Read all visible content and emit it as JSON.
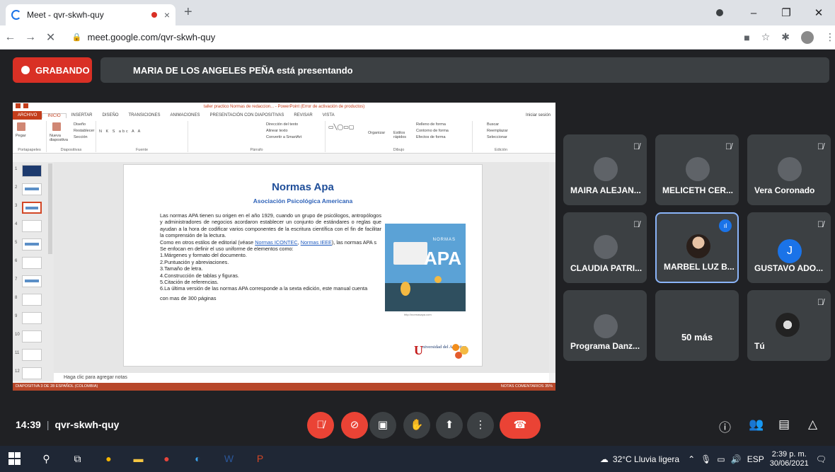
{
  "browser": {
    "tab_title": "Meet - qvr-skwh-quy",
    "url": "meet.google.com/qvr-skwh-quy",
    "new_tab": "+",
    "tab_close": "×"
  },
  "meet": {
    "recording_label": "GRABANDO",
    "presenting_label": "MARIA DE LOS ANGELES PEÑA está presentando",
    "time": "14:39",
    "meeting_code": "qvr-skwh-quy",
    "more_participants": "50 más"
  },
  "participants": [
    {
      "name": "MAIRA ALEJAN..."
    },
    {
      "name": "MELICETH CER..."
    },
    {
      "name": "Vera Coronado"
    },
    {
      "name": "CLAUDIA PATRI..."
    },
    {
      "name": "MARBEL LUZ B..."
    },
    {
      "name": "GUSTAVO ADO...",
      "initial": "J"
    },
    {
      "name": "Programa Danz..."
    },
    {
      "name": "Tú"
    }
  ],
  "powerpoint": {
    "window_title": "taller practico Normas de redaccion... - PowerPoint (Error de activación de productos)",
    "tabs": [
      "ARCHIVO",
      "INICIO",
      "INSERTAR",
      "DISEÑO",
      "TRANSICIONES",
      "ANIMACIONES",
      "PRESENTACIÓN CON DIAPOSITIVAS",
      "REVISAR",
      "VISTA"
    ],
    "signin": "Iniciar sesión",
    "groups": [
      "Portapapeles",
      "Diapositivas",
      "Fuente",
      "Párrafo",
      "Dibujo",
      "Edición"
    ],
    "ribbon_labels": {
      "paste": "Pegar",
      "new_slide": "Nueva diapositiva",
      "layout": "Diseño",
      "reset": "Restablecer",
      "section": "Sección",
      "text_direction": "Dirección del texto",
      "align_text": "Alinear texto",
      "smartart": "Convertir a SmartArt",
      "arrange": "Organizar",
      "quick_styles": "Estilos rápidos",
      "shape_fill": "Relleno de forma",
      "shape_outline": "Contorno de forma",
      "shape_effects": "Efectos de forma",
      "find": "Buscar",
      "replace": "Reemplazar",
      "select": "Seleccionar"
    },
    "slide_numbers": [
      "1",
      "2",
      "3",
      "4",
      "5",
      "6",
      "7",
      "8",
      "9",
      "10",
      "11",
      "12"
    ],
    "notes_placeholder": "Haga clic para agregar notas",
    "status_left": "DIAPOSITIVA 3 DE 28   ESPAÑOL (COLOMBIA)",
    "status_right": "NOTAS   COMENTARIOS   35%"
  },
  "slide": {
    "title": "Normas Apa",
    "subtitle": "Asociación Psicológica Americana",
    "para1": "Las normas APA tienen su origen en el año 1929, cuando un grupo de psicólogos, antropólogos y administradores de negocios acordaron establecer un conjunto de estándares o reglas que ayudan a la hora de codificar varios componentes de la escritura científica con el fin de facilitar la comprensión de la lectura.",
    "para2_pre": "Como en otros estilos de editorial (véase ",
    "link1": "Normas ICONTEC",
    "para2_mid": ", ",
    "link2": "Normas IEEE",
    "para2_post": "), las normas APA s",
    "para3": "Se enfocan en definir el uso uniforme de elementos como:",
    "list": [
      "1.Márgenes y formato del documento.",
      "2.Puntuación y abreviaciones.",
      "3.Tamaño de letra.",
      "4.Construcción de tablas y figuras.",
      "5.Citación de referencias.",
      "6.La última versión de las normas APA corresponde a la sexta edición, este manual cuenta"
    ],
    "last_line": "con mas de 300 páginas",
    "image_word_small": "NORMAS",
    "image_word_big": "APA",
    "image_url": "http://normasapa.com",
    "logo_letter": "U",
    "logo_text": "niversidad del Atlántico"
  },
  "taskbar": {
    "weather": "32°C  Lluvia ligera",
    "lang": "ESP",
    "time": "2:39 p. m.",
    "date": "30/06/2021"
  }
}
